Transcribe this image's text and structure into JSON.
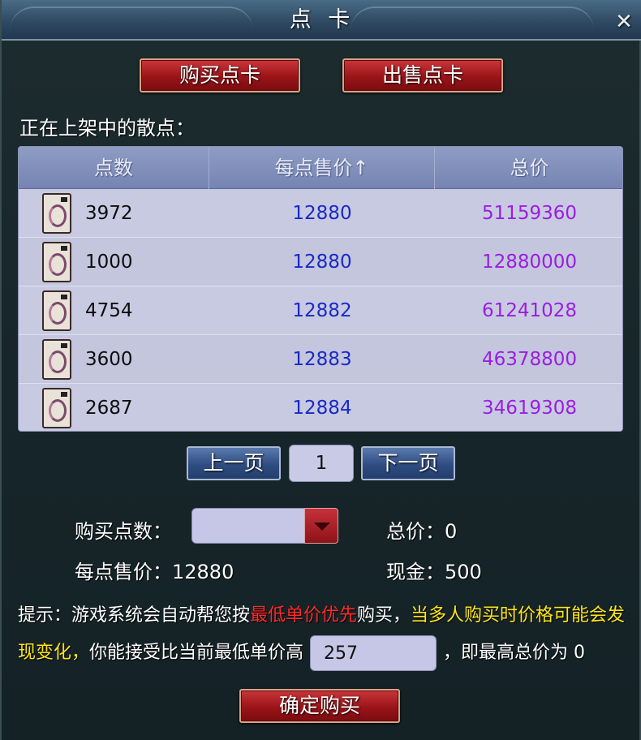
{
  "window": {
    "title": "点 卡",
    "close_glyph": "✕"
  },
  "tabs": {
    "buy": "购买点卡",
    "sell": "出售点卡"
  },
  "listing_label": "正在上架中的散点：",
  "table": {
    "headers": [
      "点数",
      "每点售价↑",
      "总价"
    ],
    "rows": [
      {
        "points": "3972",
        "unit_price": "12880",
        "total": "51159360"
      },
      {
        "points": "1000",
        "unit_price": "12880",
        "total": "12880000"
      },
      {
        "points": "4754",
        "unit_price": "12882",
        "total": "61241028"
      },
      {
        "points": "3600",
        "unit_price": "12883",
        "total": "46378800"
      },
      {
        "points": "2687",
        "unit_price": "12884",
        "total": "34619308"
      }
    ]
  },
  "pagination": {
    "prev": "上一页",
    "page": "1",
    "next": "下一页"
  },
  "form": {
    "buy_points_label": "购买点数：",
    "buy_points_value": "",
    "unit_price_text": "每点售价：12880",
    "total_text": "总价：0",
    "cash_text": "现金：500"
  },
  "tip": {
    "prefix": "提示：游戏系统会自动帮您按",
    "highlight_red": "最低单价优先",
    "mid": "购买，",
    "highlight_yellow": "当多人购买时价格可能会发现变化，",
    "accept_prefix": "你能接受比当前最低单价高",
    "accept_value": "257",
    "accept_suffix": "，即最高总价为 0"
  },
  "confirm_button": "确定购买",
  "colors": {
    "unit_price": "#1a29c4",
    "total": "#9a1ee0",
    "tip_red": "#ff2a2a",
    "tip_yellow": "#ffe51a"
  },
  "icons": {
    "row_item": "point-card-icon",
    "dropdown": "triangle-down-icon"
  }
}
